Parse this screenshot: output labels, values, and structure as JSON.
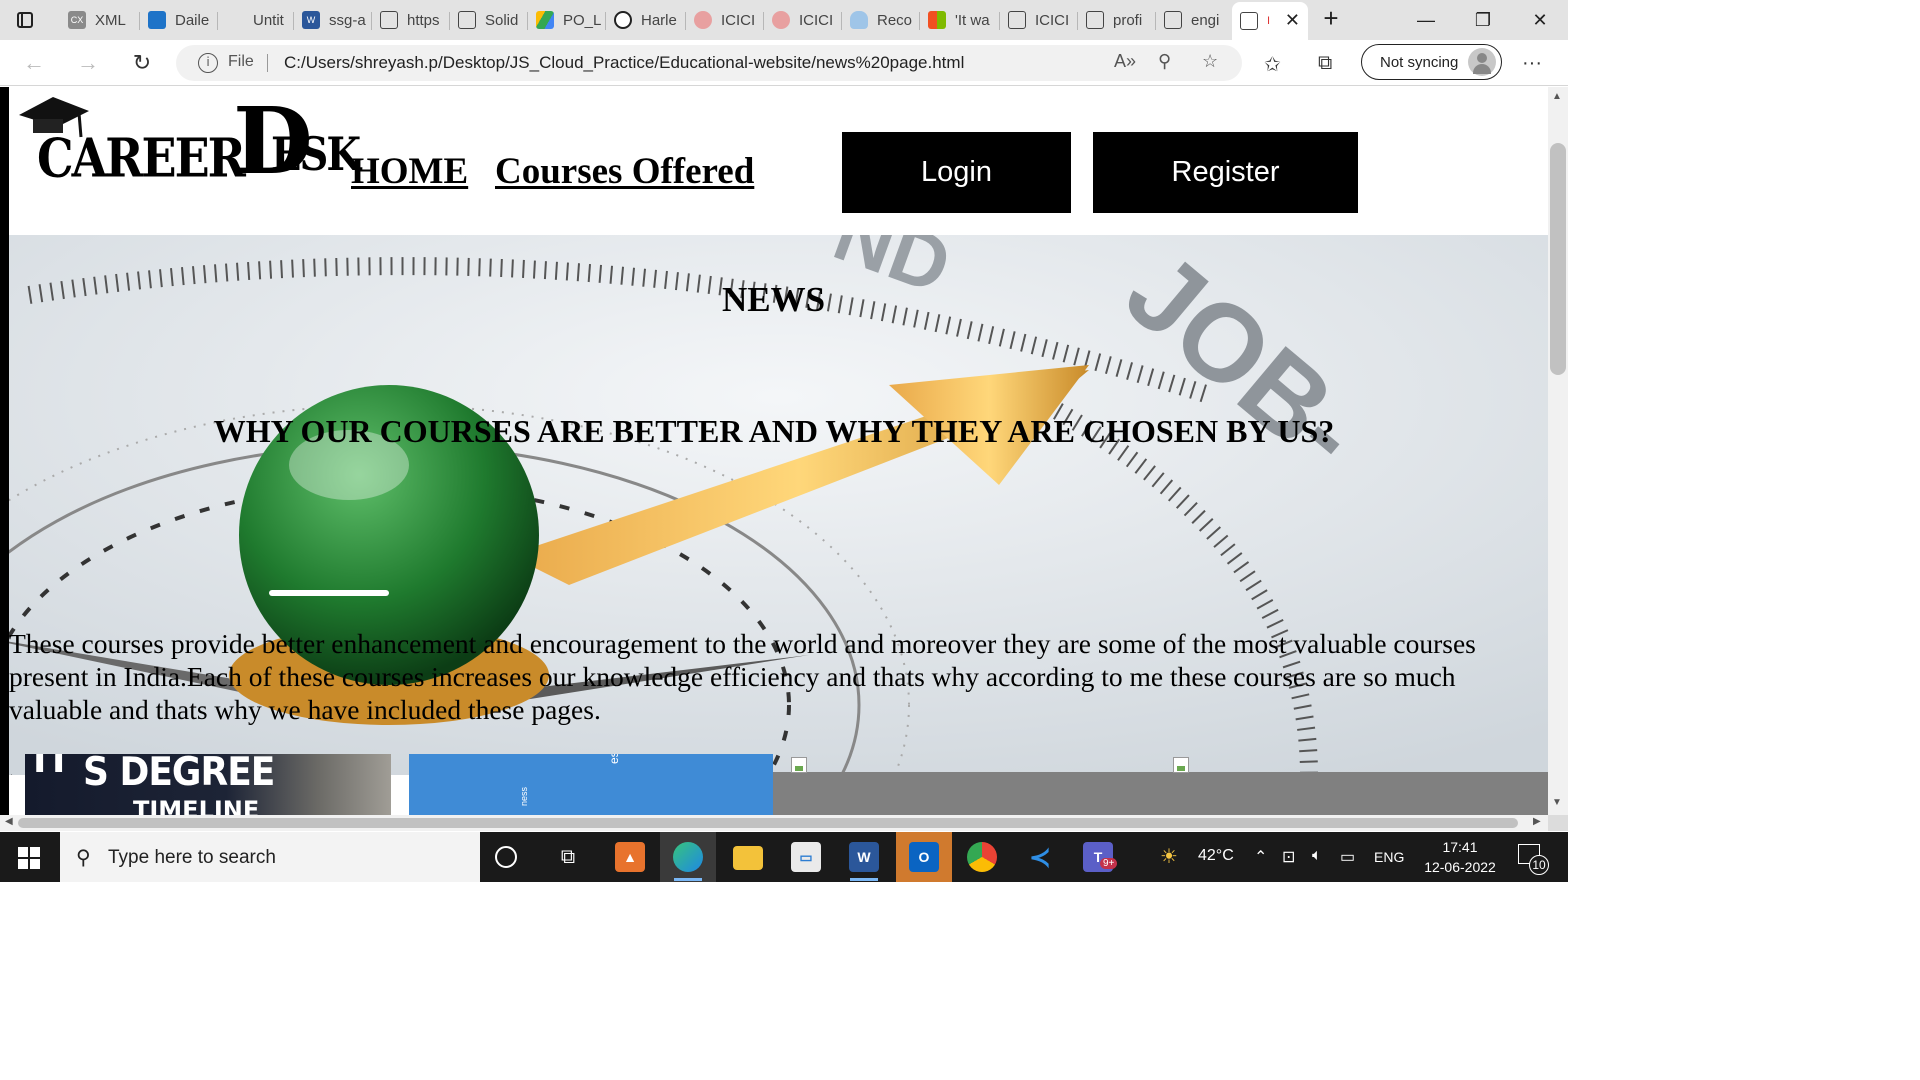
{
  "browser": {
    "tabs": [
      {
        "label": "XML",
        "icon": "xml-file-icon",
        "color": "#8a8a8a"
      },
      {
        "label": "Daile",
        "icon": "dailey-icon",
        "color": "#1e73c8"
      },
      {
        "label": "Untit",
        "icon": "blank-page-icon",
        "color": "#e3e3e3"
      },
      {
        "label": "ssg-a",
        "icon": "word-doc-icon",
        "color": "#2b579a"
      },
      {
        "label": "https",
        "icon": "document-icon",
        "color": "#e3e3e3"
      },
      {
        "label": "Solid",
        "icon": "document-icon",
        "color": "#e3e3e3"
      },
      {
        "label": "PO_L",
        "icon": "drive-icon",
        "color": "#34a853"
      },
      {
        "label": "Harle",
        "icon": "harley-icon",
        "color": "#ffffff"
      },
      {
        "label": "ICICI",
        "icon": "icici-icon",
        "color": "#d9534f"
      },
      {
        "label": "ICICI",
        "icon": "icici-icon",
        "color": "#d9534f"
      },
      {
        "label": "Reco",
        "icon": "cloud-icon",
        "color": "#6fa8dc"
      },
      {
        "label": "'It wa",
        "icon": "microsoft-icon",
        "color": "#f25022"
      },
      {
        "label": "ICICI",
        "icon": "document-icon",
        "color": "#e3e3e3"
      },
      {
        "label": "profi",
        "icon": "document-icon",
        "color": "#e3e3e3"
      },
      {
        "label": "engi",
        "icon": "document-icon",
        "color": "#e3e3e3"
      },
      {
        "label": "I",
        "icon": "document-icon",
        "color": "#ffffff"
      }
    ],
    "address": {
      "scheme_label": "File",
      "url": "C:/Users/shreyash.p/Desktop/JS_Cloud_Practice/Educational-website/news%20page.html"
    },
    "profile_label": "Not syncing"
  },
  "site": {
    "logo": {
      "part1": "CAREER",
      "part2": "DESK",
      "caption": "CAREER DESK"
    },
    "nav": {
      "home": "HOME",
      "courses": "Courses Offered"
    },
    "buttons": {
      "login": "Login",
      "register": "Register"
    },
    "hero": {
      "title": "NEWS",
      "heading": "WHY OUR COURSES ARE BETTER AND WHY THEY ARE CHOSEN BY US?",
      "paragraph": "These courses provide better enhancement and encouragement to the world and moreover they are some of the most valuable courses present in India.Each of these courses increases our knowledge efficiency and thats why according to me these courses are so much valuable and thats why we have included these pages."
    },
    "cards": {
      "card1_text": "S DEGREE",
      "card1_sub": "TIMELINE",
      "card2_text": "essional",
      "card2_sub": "ness"
    }
  },
  "taskbar": {
    "search_placeholder": "Type here to search",
    "weather": "42°C",
    "language": "ENG",
    "time": "17:41",
    "date": "12-06-2022",
    "notifications": "10",
    "teams_badge": "9+"
  }
}
